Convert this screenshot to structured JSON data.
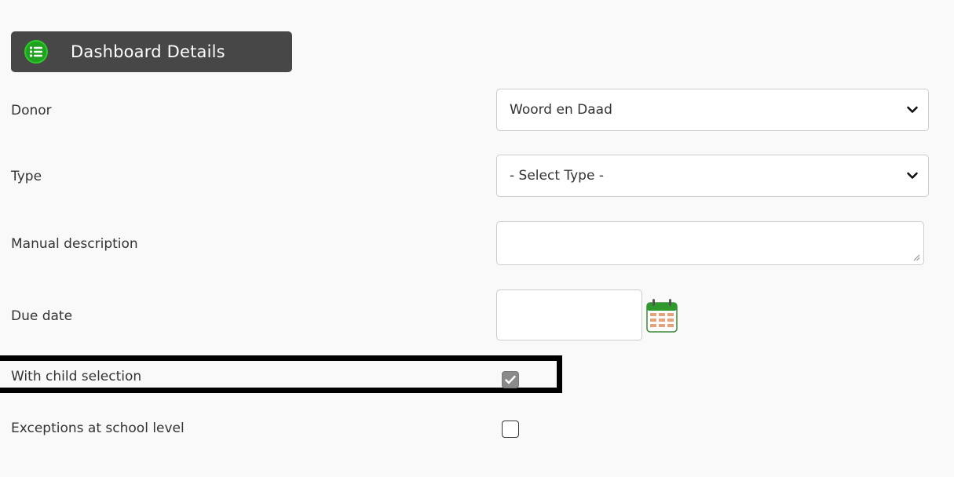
{
  "header": {
    "title": "Dashboard Details",
    "icon": "list-icon",
    "icon_color": "#1fa31f",
    "background": "#474747"
  },
  "form": {
    "donor": {
      "label": "Donor",
      "value": "Woord en Daad"
    },
    "type": {
      "label": "Type",
      "value": "- Select Type -"
    },
    "manual_description": {
      "label": "Manual description",
      "value": ""
    },
    "due_date": {
      "label": "Due date",
      "value": "",
      "icon": "calendar-icon"
    },
    "with_child_selection": {
      "label": "With child selection",
      "checked": true
    },
    "exceptions_at_school_level": {
      "label": "Exceptions at school level",
      "checked": false
    }
  }
}
